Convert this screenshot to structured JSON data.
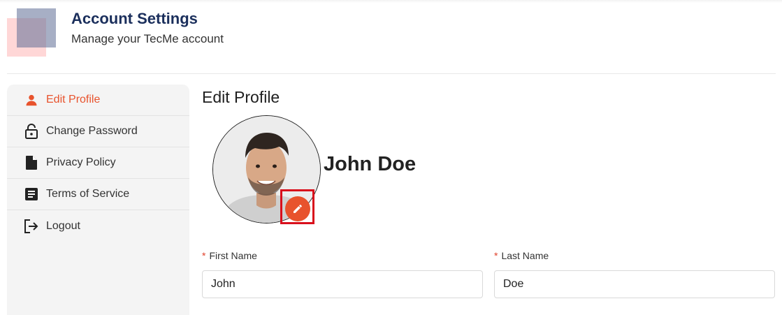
{
  "header": {
    "title": "Account Settings",
    "subtitle": "Manage your TecMe account"
  },
  "sidebar": {
    "items": [
      {
        "label": "Edit Profile",
        "icon": "person-icon",
        "active": true
      },
      {
        "label": "Change Password",
        "icon": "lock-icon",
        "active": false
      },
      {
        "label": "Privacy Policy",
        "icon": "document-icon",
        "active": false
      },
      {
        "label": "Terms of Service",
        "icon": "article-icon",
        "active": false
      },
      {
        "label": "Logout",
        "icon": "logout-icon",
        "active": false
      }
    ]
  },
  "main": {
    "title": "Edit Profile",
    "user_name": "John Doe",
    "avatar_icon": "profile-photo",
    "edit_avatar_icon": "pencil-icon",
    "form": {
      "first_name": {
        "label": "First Name",
        "value": "John",
        "required": true
      },
      "last_name": {
        "label": "Last Name",
        "value": "Doe",
        "required": true
      }
    }
  },
  "colors": {
    "accent": "#e8532d",
    "title": "#1b2f5c",
    "highlight": "#d90f1c",
    "sidebar_bg": "#f4f4f4"
  }
}
